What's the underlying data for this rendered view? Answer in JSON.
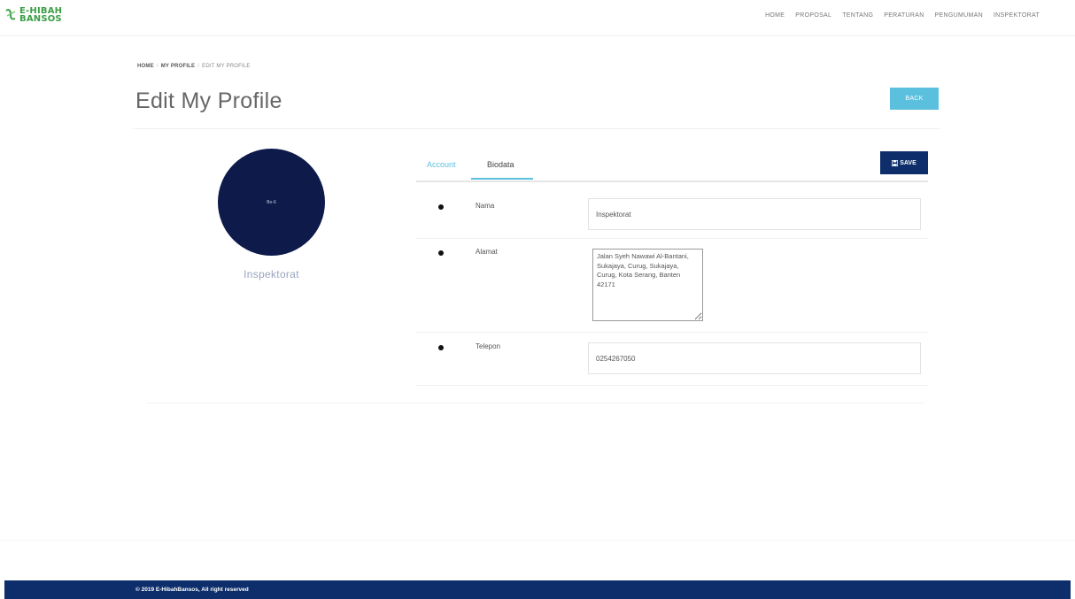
{
  "header": {
    "logo_line1": "E-HIBAH",
    "logo_line2": "BANSOS",
    "nav": [
      "HOME",
      "PROPOSAL",
      "TENTANG",
      "PERATURAN",
      "PENGUMUMAN",
      "INSPEKTORAT"
    ]
  },
  "breadcrumb": [
    "HOME",
    "MY PROFILE",
    "EDIT MY PROFILE"
  ],
  "page": {
    "title": "Edit My Profile",
    "back_label": "BACK"
  },
  "profile": {
    "avatar_text": "Bo-6",
    "name": "Inspektorat"
  },
  "tabs": {
    "account": "Account",
    "biodata": "Biodata",
    "save_label": "SAVE"
  },
  "form": {
    "nama_label": "Nama",
    "nama_value": "Inspektorat",
    "alamat_label": "Alamat",
    "alamat_value": "Jalan Syeh Nawawi Al-Bantani, Sukajaya, Curug, Sukajaya, Curug, Kota Serang, Banten 42171",
    "telepon_label": "Telepon",
    "telepon_value": "0254267050"
  },
  "footer": {
    "text": "© 2019 E-HibahBansos, All right reserved"
  },
  "colors": {
    "primary": "#0d2e6b",
    "info": "#5bc0de",
    "avatar": "#0d1a4a",
    "logo": "#3a9e44"
  }
}
